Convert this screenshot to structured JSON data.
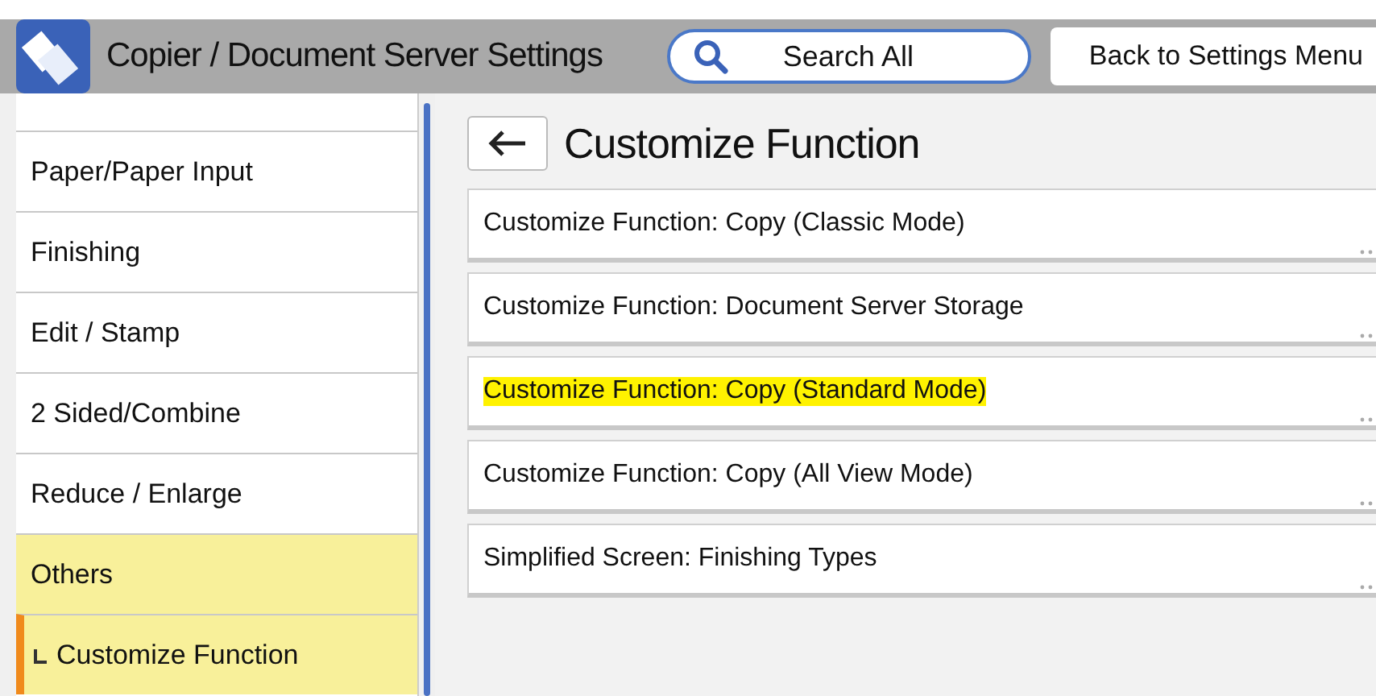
{
  "header": {
    "title": "Copier / Document Server Settings",
    "search_button": "Search All",
    "back_button": "Back to Settings Menu"
  },
  "sidebar": {
    "items": [
      {
        "label": "Paper/Paper Input",
        "selected": false,
        "kind": "item"
      },
      {
        "label": "Finishing",
        "selected": false,
        "kind": "item"
      },
      {
        "label": "Edit / Stamp",
        "selected": false,
        "kind": "item"
      },
      {
        "label": "2 Sided/Combine",
        "selected": false,
        "kind": "item"
      },
      {
        "label": "Reduce / Enlarge",
        "selected": false,
        "kind": "item"
      },
      {
        "label": "Others",
        "selected": true,
        "kind": "item"
      },
      {
        "label": "Customize Function",
        "selected": true,
        "kind": "subitem"
      }
    ]
  },
  "panel": {
    "title": "Customize Function",
    "rows": [
      {
        "label": "Customize Function: Copy (Classic Mode)",
        "highlighted": false
      },
      {
        "label": "Customize Function: Document Server Storage",
        "highlighted": false
      },
      {
        "label": "Customize Function: Copy (Standard Mode)",
        "highlighted": true
      },
      {
        "label": "Customize Function: Copy (All View Mode)",
        "highlighted": false
      },
      {
        "label": "Simplified Screen: Finishing Types",
        "highlighted": false
      }
    ]
  }
}
